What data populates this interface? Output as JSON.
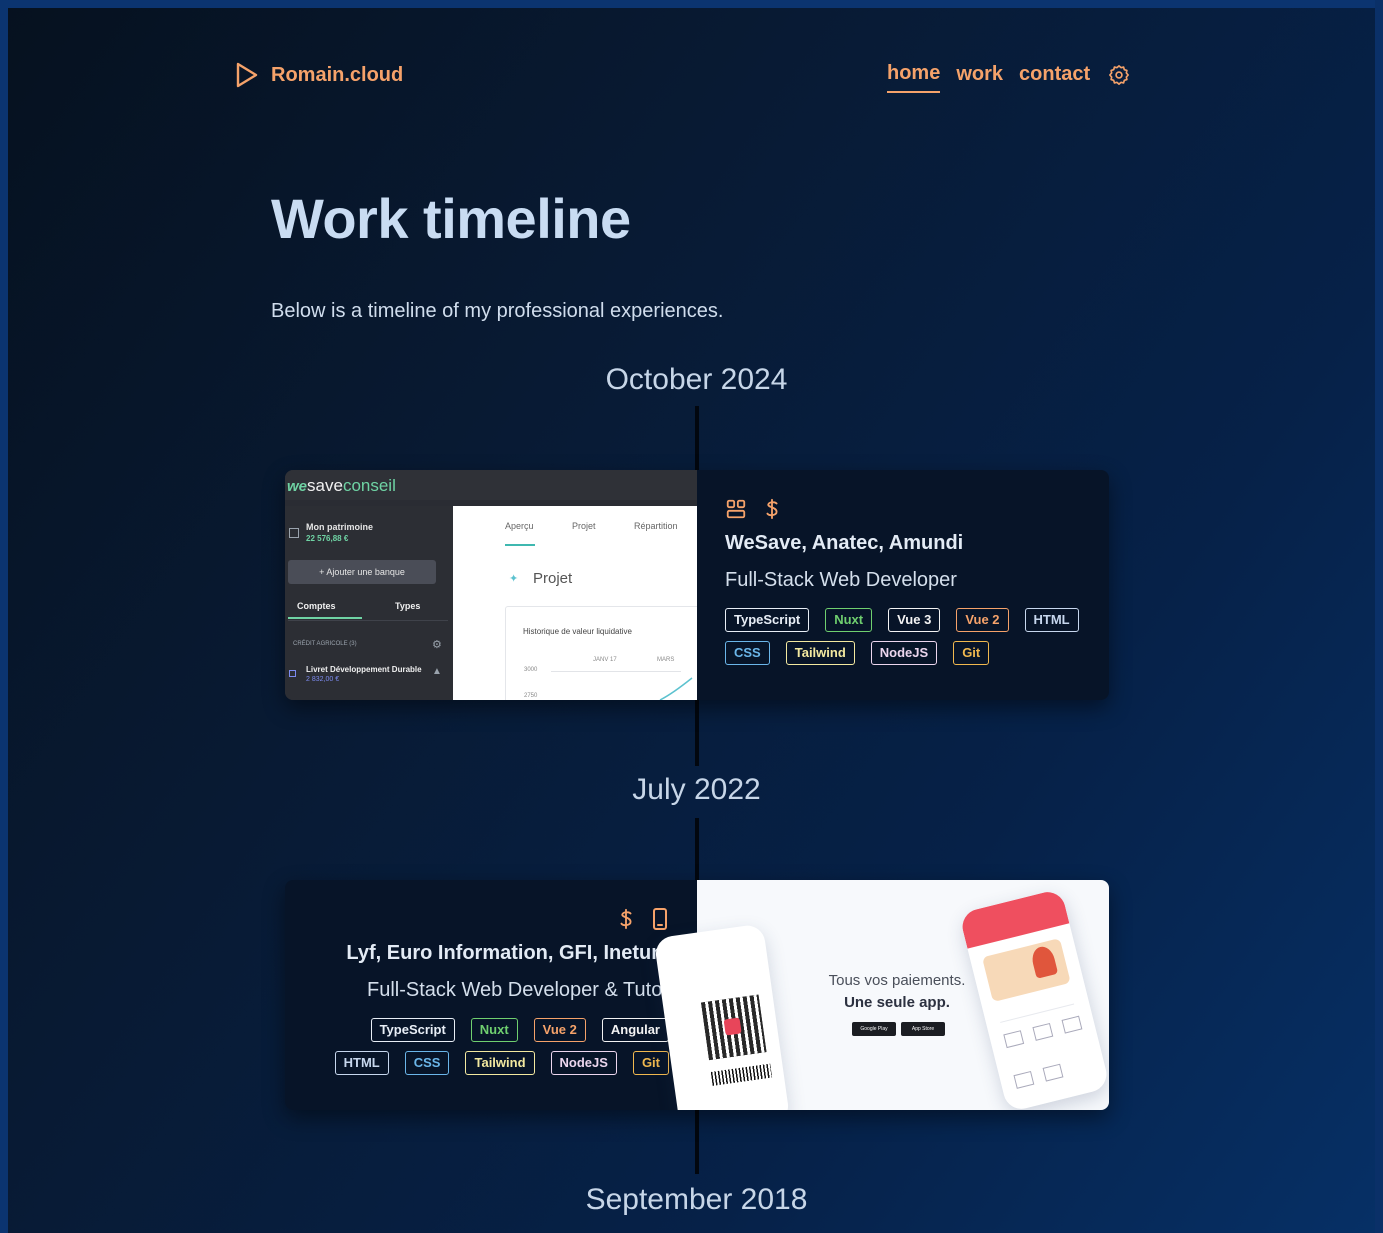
{
  "header": {
    "logo_text": "Romain.cloud",
    "nav": [
      {
        "label": "home",
        "active": true
      },
      {
        "label": "work",
        "active": false
      },
      {
        "label": "contact",
        "active": false
      }
    ]
  },
  "page": {
    "title": "Work timeline",
    "intro": "Below is a timeline of my professional experiences."
  },
  "timeline": [
    {
      "date": "October 2024",
      "company": "WeSave, Anatec, Amundi",
      "role": "Full-Stack Web Developer",
      "icons": [
        "team-icon",
        "dollar-icon"
      ],
      "tags": [
        {
          "label": "TypeScript",
          "color": "#e8eef6"
        },
        {
          "label": "Nuxt",
          "color": "#6fcf6f"
        },
        {
          "label": "Vue 3",
          "color": "#f3f3f3"
        },
        {
          "label": "Vue 2",
          "color": "#f5a26a"
        },
        {
          "label": "HTML",
          "color": "#c7d7ee"
        },
        {
          "label": "CSS",
          "color": "#6bb6ea"
        },
        {
          "label": "Tailwind",
          "color": "#f3e9a0"
        },
        {
          "label": "NodeJS",
          "color": "#ecd6ee"
        },
        {
          "label": "Git",
          "color": "#f0b84f"
        }
      ],
      "screenshot": {
        "brand_we": "we",
        "brand_save": "save",
        "brand_conseil": "conseil",
        "patrimoine_label": "Mon patrimoine",
        "patrimoine_value": "22 576,88 €",
        "add_bank": "+ Ajouter une banque",
        "tab_comptes": "Comptes",
        "tab_types": "Types",
        "bank_group": "CRÉDIT AGRICOLE (3)",
        "account_name": "Livret Développement Durable",
        "account_value": "2 832,00 €",
        "tab_apercu": "Aperçu",
        "tab_projet": "Projet",
        "tab_repartition": "Répartition",
        "projet_title": "Projet",
        "chart_title": "Historique de valeur liquidative",
        "label_janv": "JANV 17",
        "label_mars": "MARS",
        "axis_3000": "3000",
        "axis_2750": "2750"
      }
    },
    {
      "date": "July 2022",
      "company": "Lyf, Euro Information, GFI, Inetum",
      "role": "Full-Stack Web Developer & Tutor",
      "icons": [
        "dollar-icon",
        "mobile-icon"
      ],
      "tags": [
        {
          "label": "TypeScript",
          "color": "#e8eef6"
        },
        {
          "label": "Nuxt",
          "color": "#6fcf6f"
        },
        {
          "label": "Vue 2",
          "color": "#f5a26a"
        },
        {
          "label": "Angular",
          "color": "#f3f3f3"
        },
        {
          "label": "HTML",
          "color": "#c7d7ee"
        },
        {
          "label": "CSS",
          "color": "#6bb6ea"
        },
        {
          "label": "Tailwind",
          "color": "#f3e9a0"
        },
        {
          "label": "NodeJS",
          "color": "#ecd6ee"
        },
        {
          "label": "Git",
          "color": "#f0b84f"
        }
      ],
      "screenshot": {
        "headline": "Tous vos paiements.",
        "subline": "Une seule app.",
        "store_google": "Google Play",
        "store_apple": "App Store"
      }
    },
    {
      "date": "September 2018"
    }
  ],
  "colors": {
    "accent": "#f5a26a",
    "card_bg": "#071428"
  }
}
